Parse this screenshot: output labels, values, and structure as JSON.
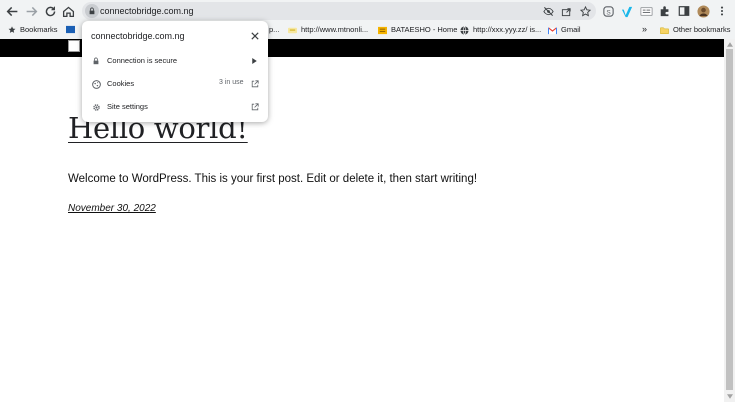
{
  "browser": {
    "url": "connectobridge.com.ng",
    "bookmarks": [
      {
        "label": "Bookmarks",
        "icon": "star-icon"
      },
      {
        "label": "http://www.mtnonli...",
        "icon": "page-icon"
      },
      {
        "label": "BATAESHO - Home",
        "icon": "yellow-site-icon"
      },
      {
        "label": "http://xxx.yyy.zz/ is...",
        "icon": "globe-icon"
      },
      {
        "label": "Gmail",
        "icon": "gmail-icon"
      }
    ],
    "partial_bookmark": "p...",
    "more_label": "»",
    "other_bookmarks": "Other bookmarks"
  },
  "site_info": {
    "domain": "connectobridge.com.ng",
    "rows": [
      {
        "label": "Connection is secure",
        "aux": "",
        "icon": "lock-icon"
      },
      {
        "label": "Cookies",
        "aux": "3 in use",
        "icon": "cookie-icon"
      },
      {
        "label": "Site settings",
        "aux": "",
        "icon": "gear-icon"
      }
    ]
  },
  "post": {
    "title": "Hello world!",
    "body": "Welcome to WordPress. This is your first post. Edit or delete it, then start writing!",
    "date": "November 30, 2022"
  },
  "colors": {
    "toolbar": "#f1f3f4",
    "omnibox": "#e3e5e8",
    "header_bar": "#000000",
    "vimeo": "#1ab7ea"
  }
}
